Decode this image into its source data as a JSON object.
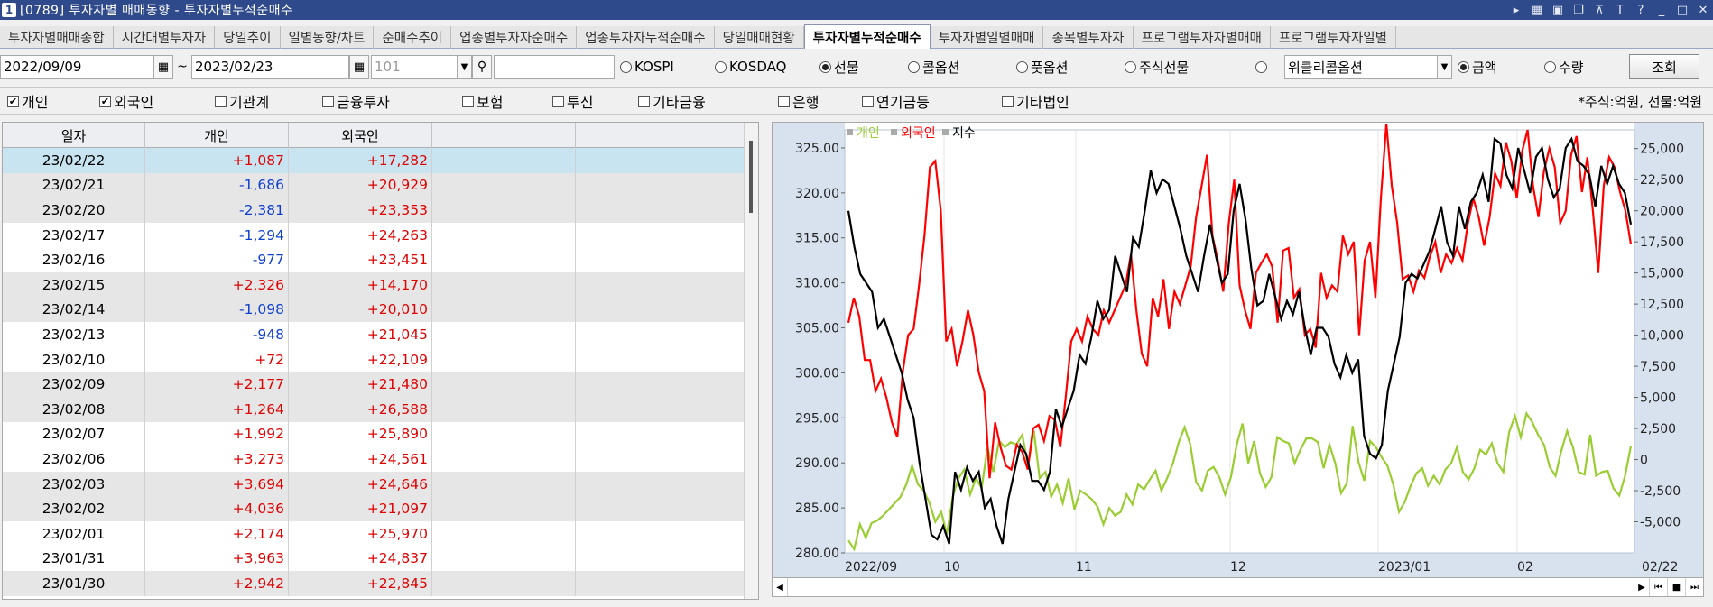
{
  "window": {
    "app_number": "1",
    "title": "[0789] 투자자별 매매동향 - 투자자별누적순매수",
    "controls": [
      "▸",
      "▦",
      "▣",
      "❐",
      "⊼",
      "T",
      "?",
      "_",
      "□",
      "✕"
    ]
  },
  "tabs": [
    {
      "label": "투자자별매매종합",
      "active": false
    },
    {
      "label": "시간대별투자자",
      "active": false
    },
    {
      "label": "당일추이",
      "active": false
    },
    {
      "label": "일별동향/차트",
      "active": false
    },
    {
      "label": "순매수추이",
      "active": false
    },
    {
      "label": "업종별투자자순매수",
      "active": false
    },
    {
      "label": "업종투자자누적순매수",
      "active": false
    },
    {
      "label": "당일매매현황",
      "active": false
    },
    {
      "label": "투자자별누적순매수",
      "active": true
    },
    {
      "label": "투자자별일별매매",
      "active": false
    },
    {
      "label": "종목별투자자",
      "active": false
    },
    {
      "label": "프로그램투자자별매매",
      "active": false
    },
    {
      "label": "프로그램투자자일별",
      "active": false
    }
  ],
  "filter": {
    "start_date": "2022/09/09",
    "tilde": "~",
    "end_date": "2023/02/23",
    "code": "101",
    "search_text": "",
    "market_options": [
      {
        "label": "KOSPI",
        "selected": false
      },
      {
        "label": "KOSDAQ",
        "selected": false
      },
      {
        "label": "선물",
        "selected": true
      },
      {
        "label": "콜옵션",
        "selected": false
      },
      {
        "label": "풋옵션",
        "selected": false
      },
      {
        "label": "주식선물",
        "selected": false
      },
      {
        "label": "",
        "selected": false
      }
    ],
    "weekly_option_select": "위클리콜옵션",
    "measure_options": [
      {
        "label": "금액",
        "selected": true
      },
      {
        "label": "수량",
        "selected": false
      }
    ],
    "query_button": "조회"
  },
  "investor_checks": [
    {
      "label": "개인",
      "checked": true
    },
    {
      "label": "외국인",
      "checked": true
    },
    {
      "label": "기관계",
      "checked": false
    },
    {
      "label": "금융투자",
      "checked": false
    },
    {
      "label": "보험",
      "checked": false
    },
    {
      "label": "투신",
      "checked": false
    },
    {
      "label": "기타금융",
      "checked": false
    },
    {
      "label": "은행",
      "checked": false
    },
    {
      "label": "연기금등",
      "checked": false
    },
    {
      "label": "기타법인",
      "checked": false
    }
  ],
  "unit_note": "*주식:억원, 선물:억원",
  "table": {
    "headers": [
      "일자",
      "개인",
      "외국인",
      "",
      "",
      ""
    ],
    "rows": [
      {
        "date": "23/02/22",
        "individual": "+1,087",
        "foreign": "+17,282"
      },
      {
        "date": "23/02/21",
        "individual": "-1,686",
        "foreign": "+20,929"
      },
      {
        "date": "23/02/20",
        "individual": "-2,381",
        "foreign": "+23,353"
      },
      {
        "date": "23/02/17",
        "individual": "-1,294",
        "foreign": "+24,263"
      },
      {
        "date": "23/02/16",
        "individual": "-977",
        "foreign": "+23,451"
      },
      {
        "date": "23/02/15",
        "individual": "+2,326",
        "foreign": "+14,170"
      },
      {
        "date": "23/02/14",
        "individual": "-1,098",
        "foreign": "+20,010"
      },
      {
        "date": "23/02/13",
        "individual": "-948",
        "foreign": "+21,045"
      },
      {
        "date": "23/02/10",
        "individual": "+72",
        "foreign": "+22,109"
      },
      {
        "date": "23/02/09",
        "individual": "+2,177",
        "foreign": "+21,480"
      },
      {
        "date": "23/02/08",
        "individual": "+1,264",
        "foreign": "+26,588"
      },
      {
        "date": "23/02/07",
        "individual": "+1,992",
        "foreign": "+25,890"
      },
      {
        "date": "23/02/06",
        "individual": "+3,273",
        "foreign": "+24,561"
      },
      {
        "date": "23/02/03",
        "individual": "+3,694",
        "foreign": "+24,646"
      },
      {
        "date": "23/02/02",
        "individual": "+4,036",
        "foreign": "+21,097"
      },
      {
        "date": "23/02/01",
        "individual": "+2,174",
        "foreign": "+25,970"
      },
      {
        "date": "23/01/31",
        "individual": "+3,963",
        "foreign": "+24,837"
      },
      {
        "date": "23/01/30",
        "individual": "+2,942",
        "foreign": "+22,845"
      }
    ]
  },
  "chart_data": {
    "type": "line",
    "legend": [
      {
        "name": "개인",
        "color": "#9acd32"
      },
      {
        "name": "외국인",
        "color": "#ff0000"
      },
      {
        "name": "지수",
        "color": "#000000"
      }
    ],
    "x_labels": [
      "2022/09",
      "10",
      "11",
      "12",
      "2023/01",
      "02",
      "02/22"
    ],
    "left_axis": {
      "ticks": [
        "325.00",
        "320.00",
        "315.00",
        "310.00",
        "305.00",
        "300.00",
        "295.00",
        "290.00",
        "285.00",
        "280.00"
      ],
      "ylim": [
        280,
        327
      ]
    },
    "right_axis": {
      "ticks": [
        "25,000",
        "22,500",
        "20,000",
        "17,500",
        "15,000",
        "12,500",
        "10,000",
        "7,500",
        "5,000",
        "2,500",
        "0",
        "-2,500",
        "-5,000"
      ],
      "ylim": [
        -7500,
        26500
      ]
    },
    "series": [
      {
        "name": "개인",
        "axis": "right",
        "color": "#9acd32",
        "values": [
          -6500,
          -7200,
          -5200,
          -6300,
          -5100,
          -4900,
          -4500,
          -4000,
          -3500,
          -3000,
          -2000,
          -500,
          -2000,
          -2500,
          -3500,
          -5000,
          -4200,
          -6000,
          -3000,
          -1500,
          -800,
          -2800,
          -1500,
          -2300,
          1000,
          -1000,
          1500,
          1000,
          1400,
          1200,
          2000,
          -500,
          2300,
          -1500,
          -1000,
          -3000,
          -2000,
          -3500,
          -1500,
          -4000,
          -2500,
          -2800,
          -3200,
          -3800,
          -5200,
          -3900,
          -4500,
          -4200,
          -2800,
          -3600,
          -2000,
          -2400,
          -1600,
          -900,
          -2500,
          -1500,
          -300,
          1400,
          2600,
          1200,
          -1800,
          -2500,
          -900,
          -600,
          -1400,
          -2800,
          -1400,
          1200,
          2900,
          -300,
          1500,
          -1100,
          -2200,
          -1400,
          1800,
          1500,
          1300,
          -300,
          800,
          1700,
          1700,
          1400,
          -700,
          1200,
          -300,
          -2700,
          -1900,
          2700,
          -200,
          -1700,
          1500,
          1000,
          200,
          -500,
          -2000,
          -4200,
          -3400,
          -2100,
          -1100,
          -700,
          -2100,
          -1300,
          -2000,
          -800,
          -300,
          1000,
          -1000,
          -1600,
          -700,
          800,
          400,
          1300,
          -300,
          -1000,
          2200,
          3500,
          1800,
          3700,
          3000,
          2000,
          1200,
          -600,
          -1300,
          700,
          2300,
          1000,
          -1000,
          -1200,
          2000,
          -1300,
          -1000,
          -900,
          -2300,
          -2900,
          -1300,
          1100
        ],
        "note": "cumulative 개인 net buy (right axis, 억원)"
      },
      {
        "name": "외국인",
        "axis": "right",
        "color": "#ff0000",
        "values": [
          11000,
          13000,
          11500,
          8000,
          8000,
          5500,
          6500,
          5000,
          3000,
          1800,
          7000,
          10000,
          10500,
          14000,
          18000,
          23500,
          24000,
          20000,
          9500,
          10500,
          7500,
          9500,
          12000,
          10000,
          7000,
          5500,
          -1500,
          3000,
          1000,
          -500,
          -800,
          1200,
          600,
          -800,
          2500,
          2800,
          1500,
          3500,
          3200,
          1000,
          5000,
          9500,
          10500,
          9500,
          11500,
          10500,
          10000,
          12000,
          11000,
          12000,
          13000,
          14000,
          16500,
          12000,
          8500,
          7500,
          13000,
          11500,
          14500,
          10500,
          13500,
          12500,
          14000,
          15500,
          19500,
          22000,
          24500,
          18000,
          16000,
          13500,
          19000,
          22500,
          14000,
          12000,
          10500,
          15000,
          15800,
          16500,
          15500,
          11000,
          16800,
          17000,
          13000,
          13700,
          10000,
          10500,
          9000,
          15000,
          13000,
          14000,
          13500,
          18000,
          16500,
          17500,
          10000,
          16000,
          17500,
          13000,
          21000,
          27000,
          22000,
          19000,
          14500,
          14800,
          13500,
          15200,
          14600,
          16300,
          17500,
          15000,
          16500,
          15800,
          17000,
          16000,
          19000,
          21000,
          19500,
          17200,
          19500,
          23000,
          22000,
          25500,
          24000,
          21000,
          24800,
          26500,
          22000,
          19500,
          23200,
          25000,
          23500,
          19000,
          20000,
          24500,
          26000,
          21500,
          24300,
          20000,
          15000,
          22000,
          24300,
          23500,
          21500,
          20000,
          17300
        ]
      },
      {
        "name": "지수",
        "axis": "left",
        "color": "#000000",
        "values": [
          318.0,
          314.0,
          311.0,
          310.0,
          309.0,
          305.0,
          306.0,
          304.0,
          302.0,
          300.0,
          297.0,
          295.0,
          290.0,
          286.0,
          282.0,
          281.5,
          283.0,
          281.0,
          289.0,
          287.0,
          289.5,
          288.0,
          289.0,
          285.0,
          286.0,
          283.0,
          281.0,
          286.0,
          289.0,
          292.0,
          291.0,
          288.0,
          288.0,
          287.0,
          289.0,
          296.0,
          294.0,
          296.0,
          298.0,
          302.0,
          301.0,
          304.0,
          308.0,
          306.0,
          307.0,
          313.0,
          311.0,
          309.0,
          315.0,
          314.0,
          318.0,
          322.5,
          320.0,
          321.5,
          321.0,
          318.5,
          316.0,
          313.0,
          311.0,
          309.0,
          313.0,
          316.5,
          313.0,
          310.0,
          311.0,
          318.0,
          321.0,
          317.0,
          311.5,
          307.5,
          308.0,
          311.0,
          308.5,
          306.0,
          308.0,
          306.5,
          309.0,
          305.0,
          302.0,
          305.0,
          305.0,
          304.0,
          301.0,
          299.5,
          302.0,
          300.0,
          301.5,
          293.0,
          291.0,
          290.5,
          292.0,
          298.0,
          301.0,
          304.0,
          310.0,
          311.0,
          310.5,
          312.0,
          313.5,
          316.0,
          318.5,
          314.5,
          313.0,
          318.5,
          316.0,
          319.0,
          320.0,
          322.0,
          319.0,
          326.0,
          325.5,
          322.0,
          320.5,
          325.0,
          322.5,
          320.0,
          324.0,
          325.0,
          321.5,
          319.5,
          320.5,
          325.0,
          326.0,
          323.5,
          323.0,
          322.0,
          318.5,
          323.0,
          321.0,
          323.0,
          321.0,
          320.0,
          316.5
        ]
      }
    ]
  }
}
